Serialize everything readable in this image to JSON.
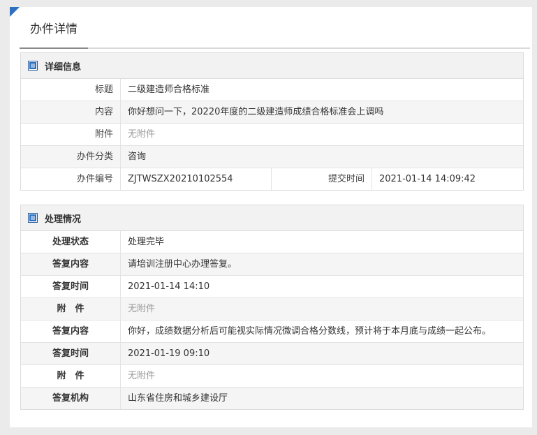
{
  "page": {
    "title": "办件详情"
  },
  "detail": {
    "heading": "详细信息",
    "rows": [
      {
        "label": "标题",
        "value": "二级建造师合格标准"
      },
      {
        "label": "内容",
        "value": "你好想问一下，20220年度的二级建造师成绩合格标准会上调吗"
      },
      {
        "label": "附件",
        "value": "无附件"
      },
      {
        "label": "办件分类",
        "value": "咨询"
      }
    ],
    "number_label": "办件编号",
    "number_value": "ZJTWSZX20210102554",
    "submit_label": "提交时间",
    "submit_value": "2021-01-14 14:09:42"
  },
  "process": {
    "heading": "处理情况",
    "rows": [
      {
        "label": "处理状态",
        "value": "处理完毕"
      },
      {
        "label": "答复内容",
        "value": "请培训注册中心办理答复。"
      },
      {
        "label": "答复时间",
        "value": "2021-01-14 14:10"
      },
      {
        "label": "附　件",
        "value": "无附件"
      },
      {
        "label": "答复内容",
        "value": "你好，成绩数据分析后可能视实际情况微调合格分数线，预计将于本月底与成绩一起公布。"
      },
      {
        "label": "答复时间",
        "value": "2021-01-19 09:10"
      },
      {
        "label": "附　件",
        "value": "无附件"
      },
      {
        "label": "答复机构",
        "value": "山东省住房和城乡建设厅"
      }
    ]
  },
  "colors": {
    "accent": "#2f6fc0",
    "header_bg": "#f2f2f2",
    "alt_row": "#f5f5f5",
    "muted": "#999999"
  },
  "icons": {
    "section_icon": "list-document-icon"
  }
}
